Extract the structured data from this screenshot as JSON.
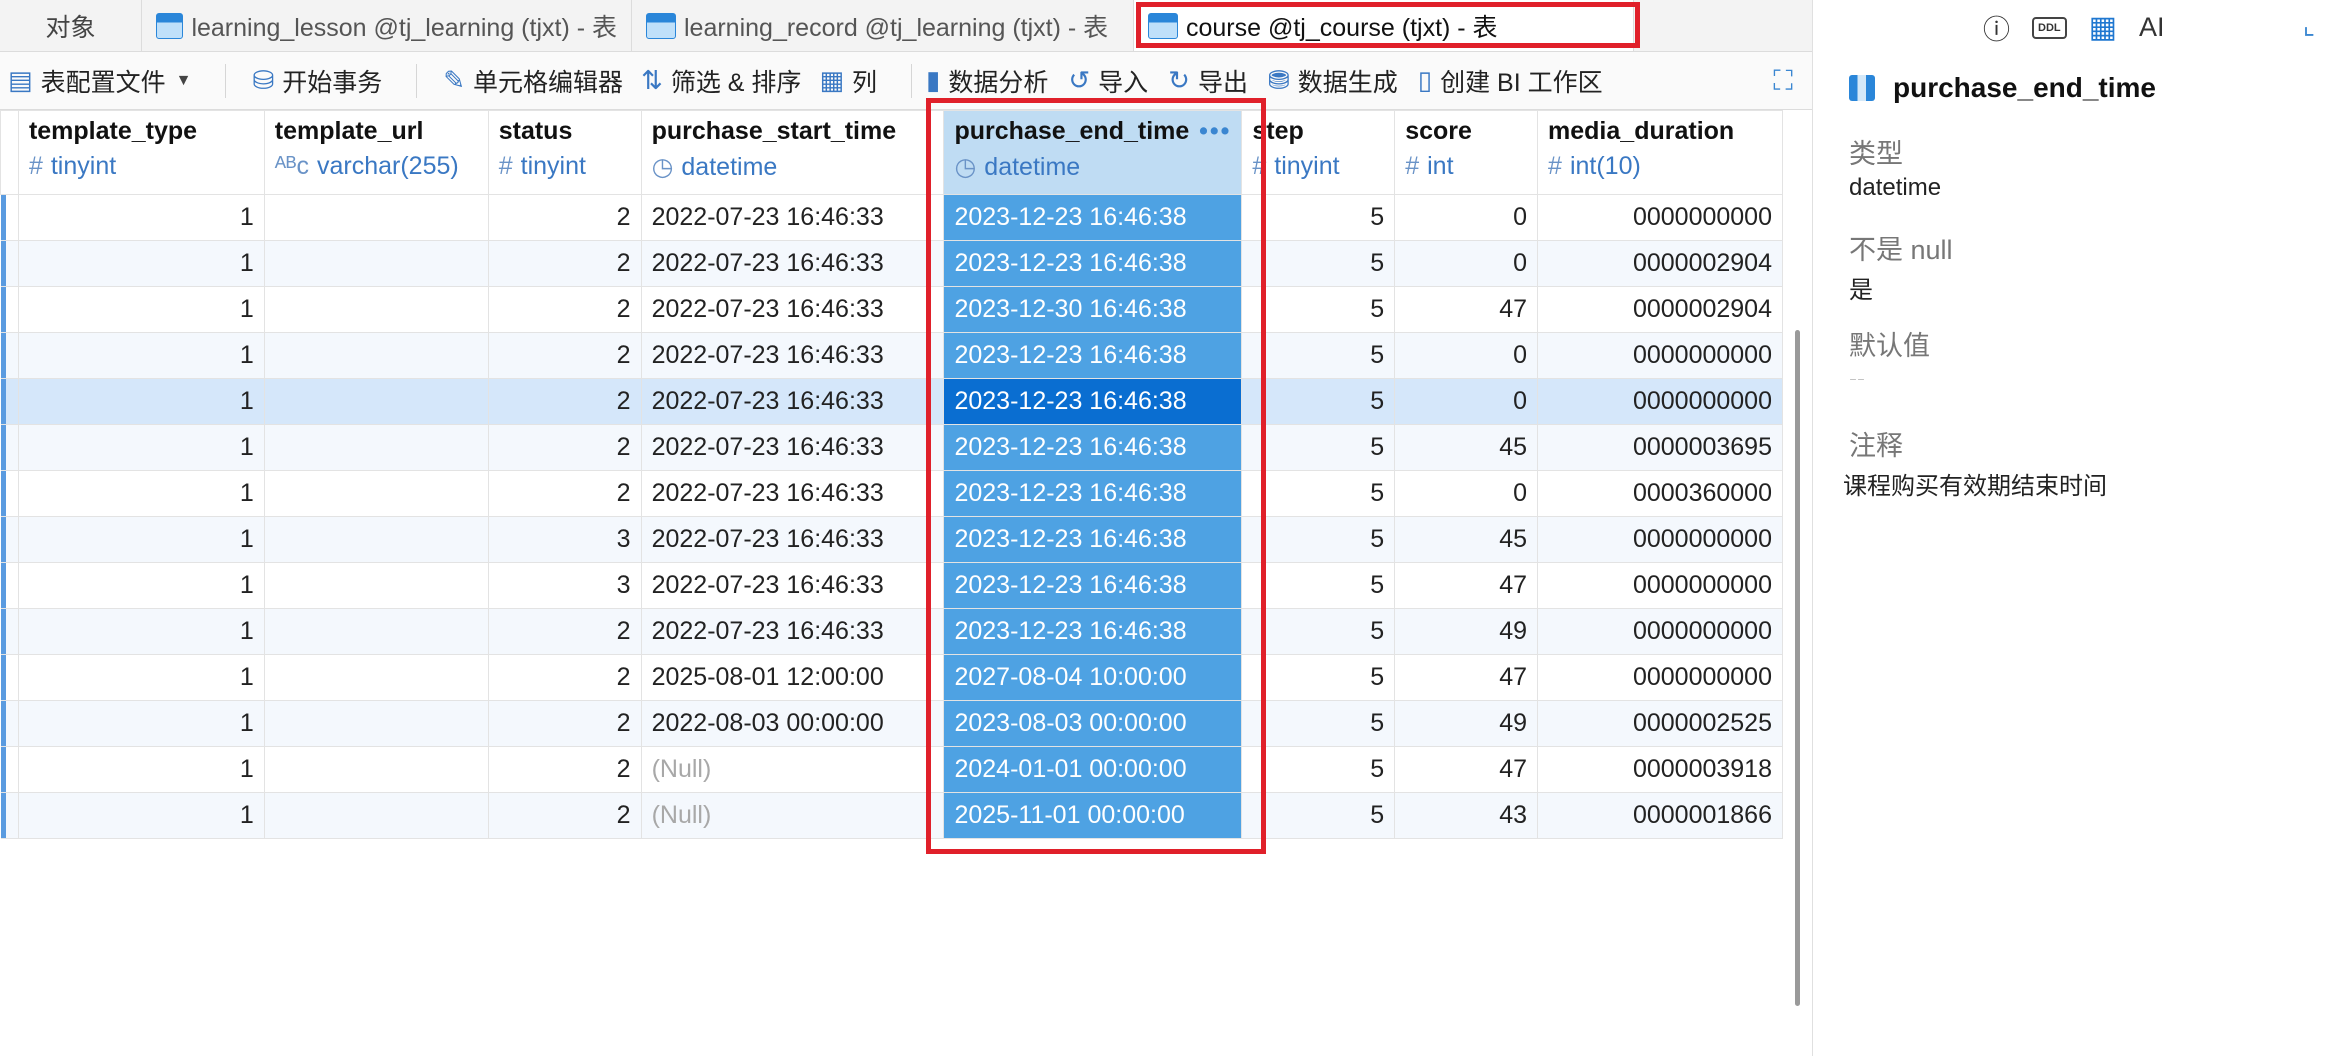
{
  "tabs": [
    {
      "label": "对象"
    },
    {
      "label": "learning_lesson @tj_learning (tjxt) - 表"
    },
    {
      "label": "learning_record @tj_learning (tjxt) - 表"
    },
    {
      "label": "course @tj_course (tjxt) - 表"
    }
  ],
  "toolbar": {
    "config_file": "表配置文件",
    "begin_tx": "开始事务",
    "cell_editor": "单元格编辑器",
    "filter_sort": "筛选 & 排序",
    "columns": "列",
    "data_analysis": "数据分析",
    "import": "导入",
    "export": "导出",
    "data_gen": "数据生成",
    "bi": "创建 BI 工作区"
  },
  "columns": [
    {
      "name": "template_type",
      "type": "tinyint",
      "glyph": "#"
    },
    {
      "name": "template_url",
      "type": "varchar(255)",
      "glyph": "ABC"
    },
    {
      "name": "status",
      "type": "tinyint",
      "glyph": "#"
    },
    {
      "name": "purchase_start_time",
      "type": "datetime",
      "glyph": "clock"
    },
    {
      "name": "purchase_end_time",
      "type": "datetime",
      "glyph": "clock"
    },
    {
      "name": "step",
      "type": "tinyint",
      "glyph": "#"
    },
    {
      "name": "score",
      "type": "int",
      "glyph": "#"
    },
    {
      "name": "media_duration",
      "type": "int(10)",
      "glyph": "#"
    }
  ],
  "rows": [
    [
      "1",
      "",
      "2",
      "2022-07-23 16:46:33",
      "2023-12-23 16:46:38",
      "5",
      "0",
      "0000000000"
    ],
    [
      "1",
      "",
      "2",
      "2022-07-23 16:46:33",
      "2023-12-23 16:46:38",
      "5",
      "0",
      "0000002904"
    ],
    [
      "1",
      "",
      "2",
      "2022-07-23 16:46:33",
      "2023-12-30 16:46:38",
      "5",
      "47",
      "0000002904"
    ],
    [
      "1",
      "",
      "2",
      "2022-07-23 16:46:33",
      "2023-12-23 16:46:38",
      "5",
      "0",
      "0000000000"
    ],
    [
      "1",
      "",
      "2",
      "2022-07-23 16:46:33",
      "2023-12-23 16:46:38",
      "5",
      "0",
      "0000000000"
    ],
    [
      "1",
      "",
      "2",
      "2022-07-23 16:46:33",
      "2023-12-23 16:46:38",
      "5",
      "45",
      "0000003695"
    ],
    [
      "1",
      "",
      "2",
      "2022-07-23 16:46:33",
      "2023-12-23 16:46:38",
      "5",
      "0",
      "0000360000"
    ],
    [
      "1",
      "",
      "3",
      "2022-07-23 16:46:33",
      "2023-12-23 16:46:38",
      "5",
      "45",
      "0000000000"
    ],
    [
      "1",
      "",
      "3",
      "2022-07-23 16:46:33",
      "2023-12-23 16:46:38",
      "5",
      "47",
      "0000000000"
    ],
    [
      "1",
      "",
      "2",
      "2022-07-23 16:46:33",
      "2023-12-23 16:46:38",
      "5",
      "49",
      "0000000000"
    ],
    [
      "1",
      "",
      "2",
      "2025-08-01 12:00:00",
      "2027-08-04 10:00:00",
      "5",
      "47",
      "0000000000"
    ],
    [
      "1",
      "",
      "2",
      "2022-08-03 00:00:00",
      "2023-08-03 00:00:00",
      "5",
      "49",
      "0000002525"
    ],
    [
      "1",
      "",
      "2",
      "(Null)",
      "2024-01-01 00:00:00",
      "5",
      "47",
      "0000003918"
    ],
    [
      "1",
      "",
      "2",
      "(Null)",
      "2025-11-01 00:00:00",
      "5",
      "43",
      "0000001866"
    ]
  ],
  "highlighted_row": 4,
  "selected_column": 4,
  "panel": {
    "field_name": "purchase_end_time",
    "type_label": "类型",
    "type_value": "datetime",
    "not_null_label": "不是 null",
    "not_null_value": "是",
    "default_label": "默认值",
    "default_value": "--",
    "comment_label": "注释",
    "comment_value": "课程购买有效期结束时间"
  },
  "colors": {
    "accent": "#1f77d0",
    "selected_col": "#4ea2e3",
    "selected_cell": "#0a6ed1",
    "annotation_red": "#e0202a"
  }
}
